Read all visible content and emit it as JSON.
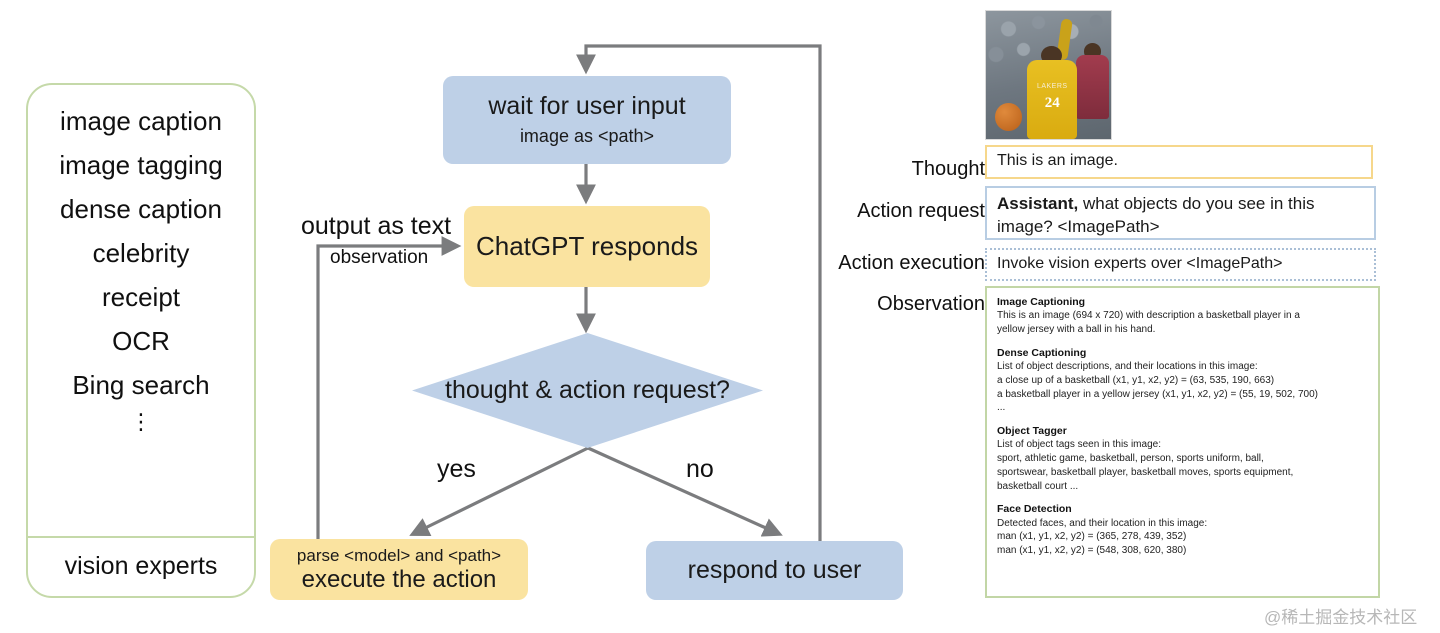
{
  "vision_experts_panel": {
    "items": [
      "image caption",
      "image tagging",
      "dense caption",
      "celebrity",
      "receipt",
      "OCR",
      "Bing search"
    ],
    "ellipsis": "⋮",
    "footer_label": "vision experts",
    "border_color": "#c5d9a9"
  },
  "flow": {
    "wait_node": {
      "title": "wait for user input",
      "subtitle": "image as <path>",
      "fill": "#bed0e7"
    },
    "chatgpt_node": {
      "title": "ChatGPT responds",
      "fill": "#fae3a0"
    },
    "decision_node": {
      "label": "thought & action request?",
      "fill": "#bed0e7"
    },
    "parse_node": {
      "subtitle": "parse <model> and <path>",
      "title": "execute the action",
      "fill": "#fae3a0"
    },
    "respond_node": {
      "title": "respond to user",
      "fill": "#bed0e7"
    },
    "edge_labels": {
      "output_as_text": "output as text",
      "observation": "observation",
      "yes": "yes",
      "no": "no"
    },
    "arrow_color": "#6f7072"
  },
  "trace": {
    "labels": {
      "thought": "Thought",
      "action_request": "Action request",
      "action_execution": "Action execution",
      "observation": "Observation"
    },
    "thought_text": "This is an image.",
    "action_request_bold": "Assistant,",
    "action_request_text": " what objects do you see in this image? <ImagePath>",
    "action_execution_text": "Invoke vision experts over <ImagePath>",
    "thumbnail": {
      "alt": "basketball-photo",
      "jersey_number": "24",
      "jersey_team": "LAKERS"
    },
    "box_colors": {
      "thought_border": "#f6d78b",
      "request_border": "#b8cde3",
      "execution_border": "#aabfd6",
      "observation_border": "#c2d6a6"
    },
    "observation": {
      "sections": [
        {
          "title": "Image Captioning",
          "lines": [
            "This is an image (694 x 720) with description a basketball player in a",
            "yellow jersey with a ball in his hand."
          ]
        },
        {
          "title": "Dense Captioning",
          "lines": [
            "List of object descriptions, and their locations in this image:",
            "a close up of a basketball (x1, y1, x2, y2)  = (63, 535, 190, 663)",
            "a basketball player in a yellow jersey (x1, y1, x2, y2)  = (55, 19, 502, 700)",
            "..."
          ]
        },
        {
          "title": "Object Tagger",
          "lines": [
            "List of object tags seen in this image:",
            "sport, athletic game, basketball, person, sports uniform, ball,",
            "sportswear, basketball player, basketball moves, sports equipment,",
            "basketball court ..."
          ]
        },
        {
          "title": "Face Detection",
          "lines": [
            "Detected faces, and their location in this image:",
            "man (x1, y1, x2, y2)  = (365, 278, 439, 352)",
            "man (x1, y1, x2, y2)  = (548, 308, 620, 380)"
          ]
        }
      ]
    }
  },
  "watermark": "@稀土掘金技术社区"
}
